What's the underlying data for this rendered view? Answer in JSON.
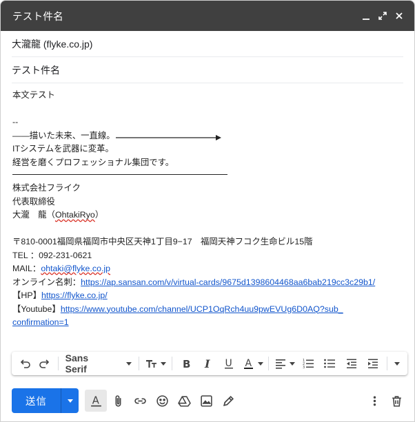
{
  "window": {
    "title": "テスト件名"
  },
  "compose": {
    "recipient": "大瀧龍 (flyke.co.jp)",
    "subject": "テスト件名"
  },
  "body": {
    "greeting": "本文テスト",
    "sig_dashes": "--",
    "tagline_prefix": "——描いた未来、一直線。",
    "tagline2": "ITシステムを武器に変革。",
    "tagline3": "経営を磨くプロフェッショナル集団です。",
    "company": "株式会社フライク",
    "position": "代表取締役",
    "name_prefix": "大瀧　龍（",
    "name_romaji": "OhtakiRyo",
    "name_suffix": "）",
    "address": "〒810-0001福岡県福岡市中央区天神1丁目9−17　福岡天神フコク生命ビル15階",
    "tel": "TEL ：092-231-0621",
    "mail_label": "MAIL：",
    "mail_link": "ohtaki@flyke.co.jp",
    "card_label": "オンライン名刺：",
    "card_link": "https://ap.sansan.com/v/virtual-cards/9675d1398604468aa6bab219cc3c29b1/",
    "hp_label": "【HP】",
    "hp_link": "https://flyke.co.jp/",
    "yt_label": "【Youtube】",
    "yt_link_1": "https://www.youtube.com/channel/UCP1OqRch4uu9pwEVUg6D0AQ?sub_",
    "yt_link_2": "confirmation=1"
  },
  "toolbar": {
    "font": "Sans Serif"
  },
  "actions": {
    "send_label": "送信"
  },
  "colors": {
    "titlebar": "#404040",
    "send": "#1a73e8",
    "link": "#1155cc"
  }
}
